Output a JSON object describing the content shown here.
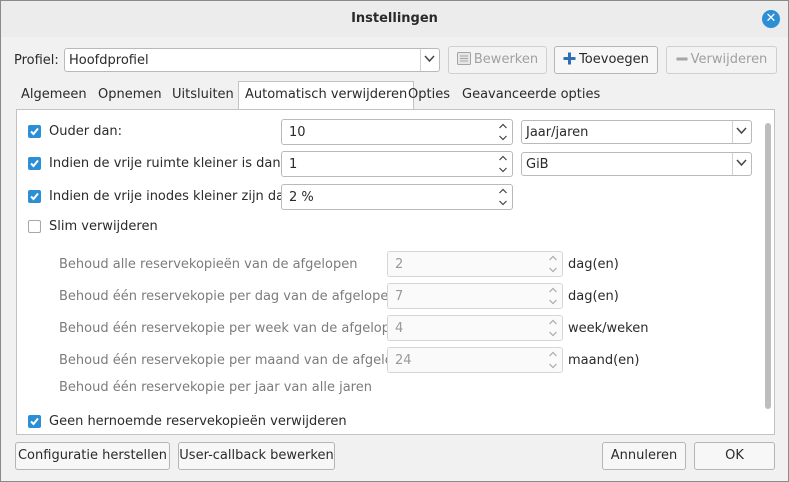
{
  "window": {
    "title": "Instellingen"
  },
  "profile": {
    "label": "Profiel:",
    "value": "Hoofdprofiel",
    "edit_label": "Bewerken",
    "add_label": "Toevoegen",
    "remove_label": "Verwijderen"
  },
  "tabs": [
    "Algemeen",
    "Opnemen",
    "Uitsluiten",
    "Automatisch verwijderen",
    "Opties",
    "Geavanceerde opties"
  ],
  "active_tab": "Automatisch verwijderen",
  "rules": {
    "older_than": {
      "label": "Ouder dan:",
      "checked": true,
      "value": "10",
      "unit": "Jaar/jaren"
    },
    "free_space": {
      "label": "Indien de vrije ruimte kleiner is dan:",
      "checked": true,
      "value": "1",
      "unit": "GiB"
    },
    "free_inodes": {
      "label": "Indien de vrije inodes kleiner zijn dan:",
      "checked": true,
      "value": "2 %"
    },
    "smart_remove": {
      "label": "Slim verwijderen",
      "checked": false
    },
    "keep_all": {
      "label": "Behoud alle reservekopieën van de afgelopen",
      "value": "2",
      "unit": "dag(en)"
    },
    "keep_day": {
      "label": "Behoud één reservekopie per dag van de afgelopen",
      "value": "7",
      "unit": "dag(en)"
    },
    "keep_week": {
      "label": "Behoud één reservekopie per week van de afgelopen",
      "value": "4",
      "unit": "week/weken"
    },
    "keep_month": {
      "label": "Behoud één reservekopie per maand van de afgelopen",
      "value": "24",
      "unit": "maand(en)"
    },
    "keep_year": {
      "label": "Behoud één reservekopie per jaar van alle jaren"
    },
    "dont_remove_named": {
      "label": "Geen hernoemde reservekopieën verwijderen",
      "checked": true
    }
  },
  "footer": {
    "restore_label": "Configuratie herstellen",
    "callback_label": "User-callback bewerken",
    "cancel_label": "Annuleren",
    "ok_label": "OK"
  },
  "colors": {
    "accent": "#2c8fd6",
    "panel_bg": "#ffffff",
    "window_bg": "#f1f1f1"
  }
}
